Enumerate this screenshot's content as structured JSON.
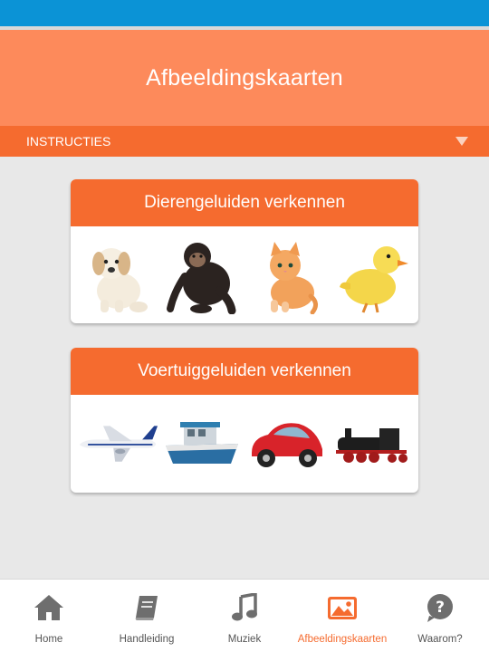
{
  "header": {
    "title": "Afbeeldingskaarten"
  },
  "instructions": {
    "label": "INSTRUCTIES",
    "icon": "triangle-down-icon"
  },
  "cards": [
    {
      "title": "Dierengeluiden verkennen",
      "images": [
        "puppy",
        "chimpanzee",
        "kitten",
        "duckling"
      ]
    },
    {
      "title": "Voertuiggeluiden verkennen",
      "images": [
        "airplane",
        "boat",
        "red-beetle-car",
        "steam-locomotive"
      ]
    }
  ],
  "nav": {
    "items": [
      {
        "label": "Home",
        "icon": "home-icon",
        "active": false
      },
      {
        "label": "Handleiding",
        "icon": "book-icon",
        "active": false
      },
      {
        "label": "Muziek",
        "icon": "music-note-icon",
        "active": false
      },
      {
        "label": "Afbeeldingskaarten",
        "icon": "image-icon",
        "active": true
      },
      {
        "label": "Waarom?",
        "icon": "question-icon",
        "active": false
      }
    ]
  },
  "colors": {
    "status_bar": "#0b93d6",
    "header": "#fd8a5b",
    "accent": "#f56b2f",
    "icon_gray": "#6e6e6e",
    "background": "#e8e8e8"
  }
}
